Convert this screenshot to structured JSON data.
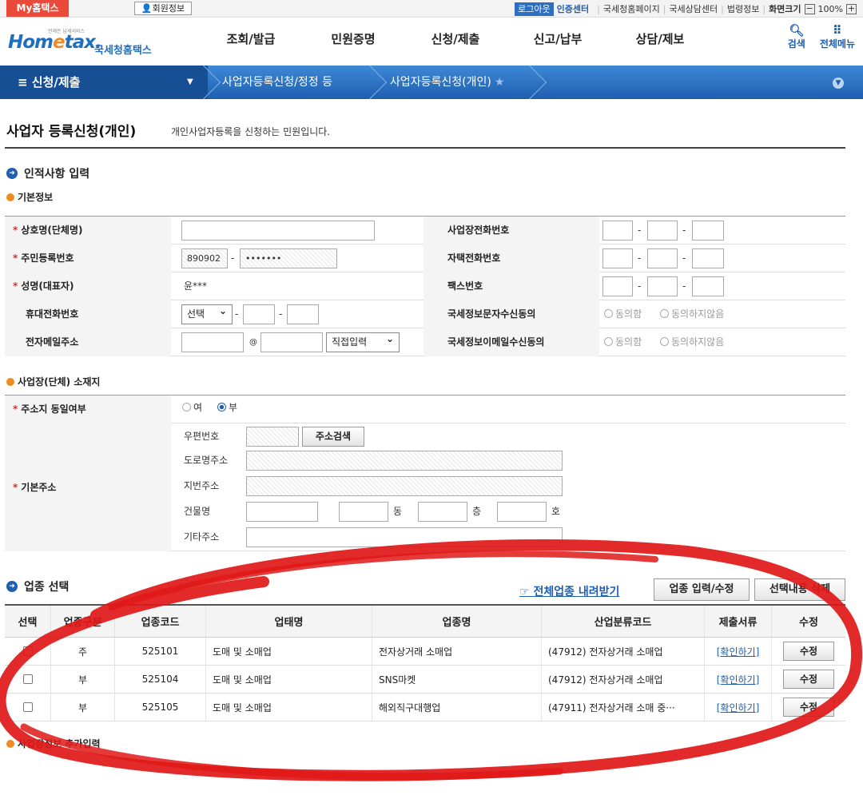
{
  "top": {
    "myhome": "My홈택스",
    "member": "회원정보",
    "logout": "로그아웃",
    "cert": "인증센터",
    "links": [
      "국세청홈페이지",
      "국세상담센터",
      "법령정보"
    ],
    "screen": "화면크기",
    "zoom": "100%"
  },
  "logo": {
    "small": "언제든 납세서비스",
    "main_a": "Hom",
    "main_e": "e",
    "main_b": "tax.",
    "sub": "국세청홈택스"
  },
  "nav": [
    "조회/발급",
    "민원증명",
    "신청/제출",
    "신고/납부",
    "상담/제보"
  ],
  "icons": {
    "search": "검색",
    "menu": "전체메뉴"
  },
  "navbar": {
    "category": "≡ 신청/제출",
    "crumb1": "사업자등록신청/정정 등",
    "crumb2": "사업자등록신청(개인)"
  },
  "title": "사업자 등록신청(개인)",
  "desc": "개인사업자등록을 신청하는 민원입니다.",
  "sec1": "인적사항 입력",
  "sub1": "기본정보",
  "basic": {
    "l_shop": "상호명(단체명)",
    "l_bizphone": "사업장전화번호",
    "l_rrn": "주민등록번호",
    "rrn1": "890902",
    "rrn2": "•••••••",
    "l_homephone": "자택전화번호",
    "l_name": "성명(대표자)",
    "name": "윤***",
    "l_fax": "팩스번호",
    "l_mobile": "휴대전화번호",
    "mobile_sel": "선택",
    "l_sms": "국세정보문자수신동의",
    "agree": "동의함",
    "disagree": "동의하지않음",
    "l_email": "전자메일주소",
    "at": "@",
    "email_sel": "직접입력",
    "l_emailagree": "국세정보이메일수신동의"
  },
  "sub2": "사업장(단체) 소재지",
  "addr": {
    "l_same": "주소지 동일여부",
    "yes": "여",
    "no": "부",
    "l_base": "기본주소",
    "zip": "우편번호",
    "search": "주소검색",
    "road": "도로명주소",
    "jibun": "지번주소",
    "bldg": "건물명",
    "dong": "동",
    "floor": "층",
    "ho": "호",
    "etc": "기타주소"
  },
  "sec2": "업종 선택",
  "tools": {
    "download": "전체업종 내려받기",
    "edit": "업종 입력/수정",
    "delete": "선택내용 삭제"
  },
  "table": {
    "headers": [
      "선택",
      "업종구분",
      "업종코드",
      "업태명",
      "업종명",
      "산업분류코드",
      "제출서류",
      "수정"
    ],
    "rows": [
      {
        "type": "주",
        "code": "525101",
        "biz": "도매 및 소매업",
        "item": "전자상거래 소매업",
        "ksic": "(47912) 전자상거래 소매업",
        "doc": "[확인하기]",
        "edit": "수정"
      },
      {
        "type": "부",
        "code": "525104",
        "biz": "도매 및 소매업",
        "item": "SNS마켓",
        "ksic": "(47912) 전자상거래 소매업",
        "doc": "[확인하기]",
        "edit": "수정"
      },
      {
        "type": "부",
        "code": "525105",
        "biz": "도매 및 소매업",
        "item": "해외직구대행업",
        "ksic": "(47911) 전자상거래 소매 중···",
        "doc": "[확인하기]",
        "edit": "수정"
      }
    ]
  },
  "sub3": "사업장정보 추가입력"
}
